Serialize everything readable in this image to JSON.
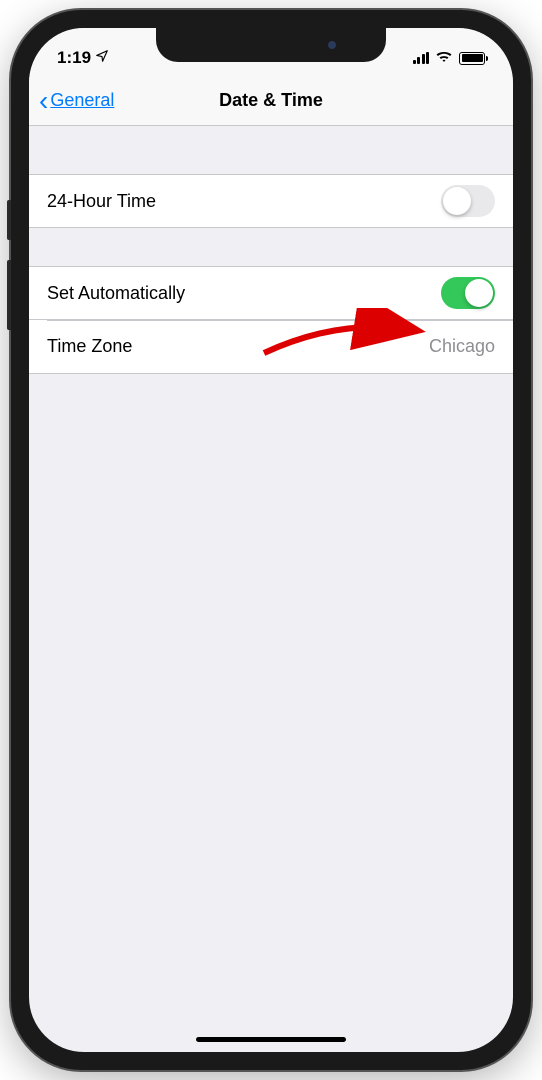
{
  "status": {
    "time": "1:19",
    "location_icon": "location-icon"
  },
  "nav": {
    "back_label": "General",
    "title": "Date & Time"
  },
  "sections": [
    {
      "rows": [
        {
          "label": "24-Hour Time",
          "type": "toggle",
          "on": false
        }
      ]
    },
    {
      "rows": [
        {
          "label": "Set Automatically",
          "type": "toggle",
          "on": true
        },
        {
          "label": "Time Zone",
          "type": "value",
          "value": "Chicago"
        }
      ]
    }
  ]
}
